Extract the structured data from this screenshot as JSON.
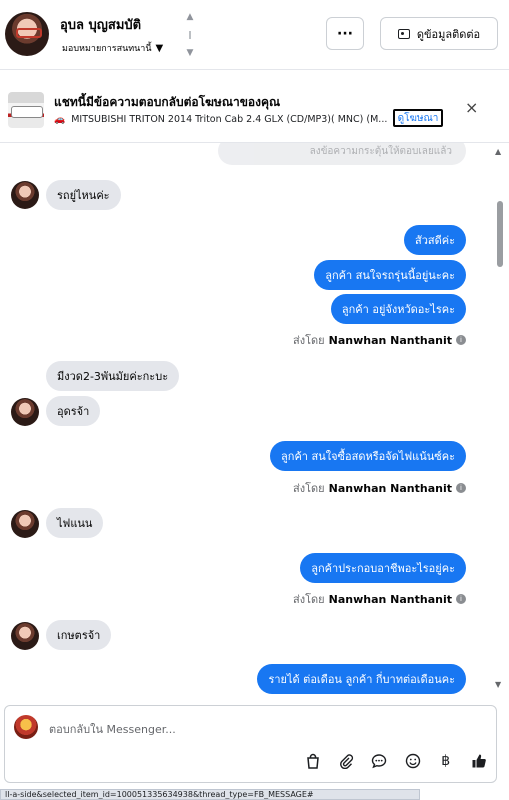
{
  "header": {
    "contact_name": "อุบล บุญสมบัติ",
    "assign_label": "มอบหมายการสนทนานี้",
    "more_label": "···",
    "contact_button_label": "ดูข้อมูลติดต่อ"
  },
  "ad": {
    "title": "แชทนี้มีข้อความตอบกลับต่อโฆษณาของคุณ",
    "subtitle": "MITSUBISHI TRITON 2014 Triton Cab 2.4 GLX (CD/MP3)( MNC) (M...",
    "link_label": "ดูโฆษณา",
    "close_label": "×"
  },
  "chat": {
    "faded_text": "ลงข้อความกระตุ้นให้ตอบเลยแล้ว",
    "messages": [
      {
        "text": "รถยู่ไหนค่ะ"
      },
      {
        "text": "สัวสดีค่ะ"
      },
      {
        "text": "ลูกค้า สนใจรถรุ่นนี้อยู่นะคะ"
      },
      {
        "text": "ลูกค้า อยู่จังหวัดอะไรคะ"
      },
      {
        "text": "มีงวด2-3พันมัยค่ะกะบะ"
      },
      {
        "text": "อุดรจ้า"
      },
      {
        "text": "ลูกค้า  สนใจซื้อสดหรือจัดไฟแน้นซ์คะ"
      },
      {
        "text": "ไฟแนน"
      },
      {
        "text": "ลูกค้าประกอบอาชีพอะไรอยู่คะ"
      },
      {
        "text": "เกษตรจ้า"
      },
      {
        "text": "รายได้ ต่อเดือน  ลูกค้า กี่บาทต่อเดือนคะ"
      }
    ],
    "sent_by_prefix": "ส่งโดย",
    "sent_by_name": "Nanwhan Nanthanit",
    "info_icon": "i"
  },
  "composer": {
    "placeholder": "ตอบกลับใน Messenger..."
  },
  "status_url": "ll-a-side&selected_item_id=100051335634938&thread_type=FB_MESSAGE#",
  "colors": {
    "outgoing_bubble": "#1877f2",
    "incoming_bubble": "#e4e6eb",
    "accent": "#1877f2"
  }
}
